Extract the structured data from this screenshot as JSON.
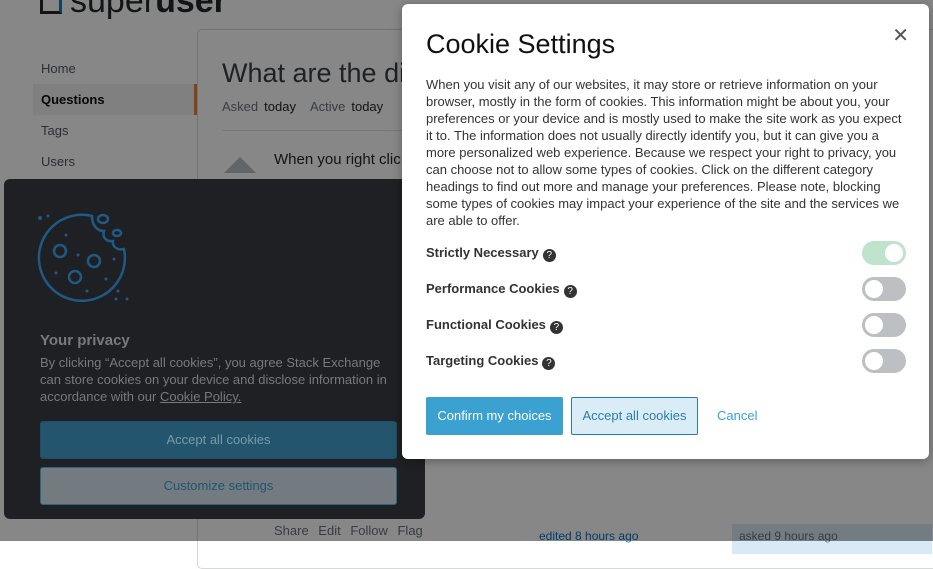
{
  "site": {
    "logo_light": "super",
    "logo_bold": "user"
  },
  "nav": {
    "items": [
      {
        "label": "Home"
      },
      {
        "label": "Questions",
        "active": true
      },
      {
        "label": "Tags"
      },
      {
        "label": "Users"
      }
    ]
  },
  "question": {
    "title": "What are the di",
    "asked_label": "Asked",
    "asked_value": "today",
    "active_label": "Active",
    "active_value": "today",
    "body": "When you right clic",
    "actions": "Share Edit Follow Flag",
    "edited": "edited 8 hours ago",
    "asked_card": "asked 9 hours ago"
  },
  "banner": {
    "icon": "cookie-icon",
    "title": "Your privacy",
    "text": "By clicking “Accept all cookies”, you agree Stack Exchange can store cookies on your device and disclose information in accordance with our ",
    "policy_link": "Cookie Policy.",
    "accept": "Accept all cookies",
    "customize": "Customize settings"
  },
  "modal": {
    "title": "Cookie Settings",
    "close_icon": "close-icon",
    "description": "When you visit any of our websites, it may store or retrieve information on your browser, mostly in the form of cookies. This information might be about you, your preferences or your device and is mostly used to make the site work as you expect it to. The information does not usually directly identify you, but it can give you a more personalized web experience. Because we respect your right to privacy, you can choose not to allow some types of cookies. Click on the different category headings to find out more and manage your preferences. Please note, blocking some types of cookies may impact your experience of the site and the services we are able to offer.",
    "categories": [
      {
        "label": "Strictly Necessary",
        "enabled": true
      },
      {
        "label": "Performance Cookies",
        "enabled": false
      },
      {
        "label": "Functional Cookies",
        "enabled": false
      },
      {
        "label": "Targeting Cookies",
        "enabled": false
      }
    ],
    "confirm": "Confirm my choices",
    "accept_all": "Accept all cookies",
    "cancel": "Cancel"
  },
  "colors": {
    "accent": "#3aa1d0",
    "toggle_on": "#bfe3cc",
    "toggle_off": "#bcc0c3"
  }
}
